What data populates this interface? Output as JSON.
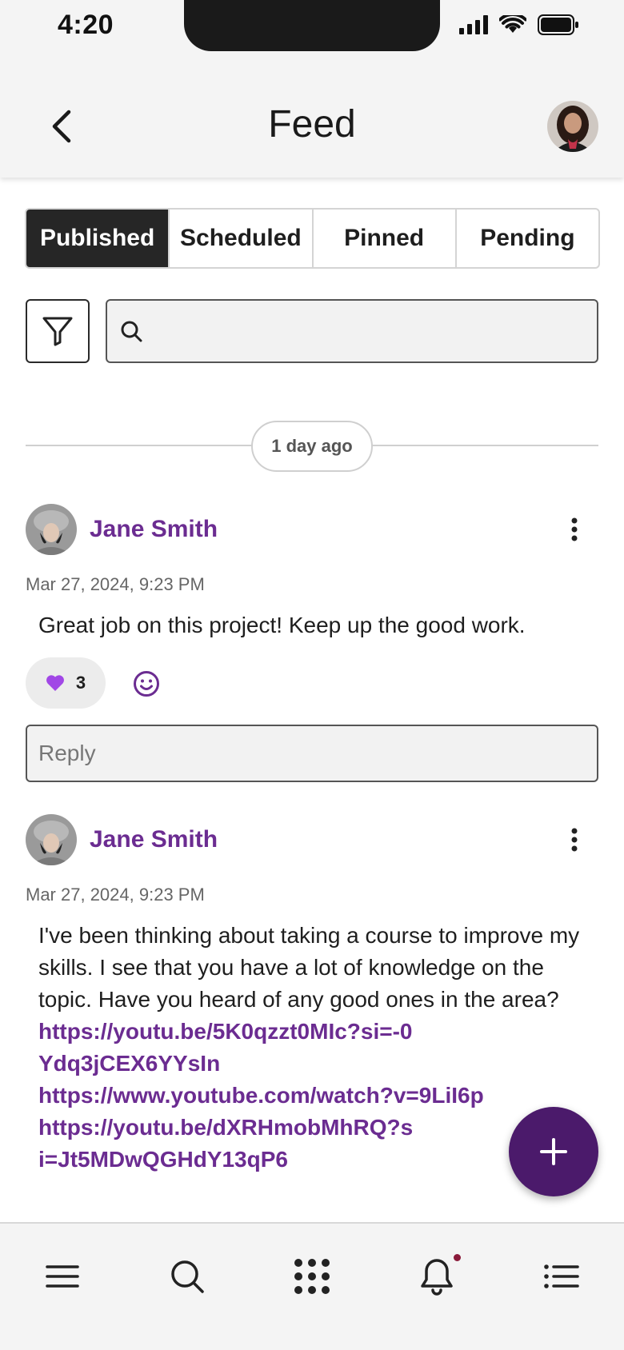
{
  "status_bar": {
    "time": "4:20"
  },
  "header": {
    "title": "Feed"
  },
  "tabs": [
    {
      "label": "Published",
      "active": true
    },
    {
      "label": "Scheduled",
      "active": false
    },
    {
      "label": "Pinned",
      "active": false
    },
    {
      "label": "Pending",
      "active": false
    }
  ],
  "search": {
    "placeholder": "",
    "value": ""
  },
  "date_divider": "1 day ago",
  "posts": [
    {
      "author": "Jane Smith",
      "timestamp": "Mar 27, 2024, 9:23 PM",
      "body": "Great job on this project! Keep up the good work.",
      "reaction": {
        "icon": "purple-heart-icon",
        "count": "3"
      },
      "reply_placeholder": "Reply"
    },
    {
      "author": "Jane Smith",
      "timestamp": "Mar 27, 2024, 9:23 PM",
      "body": "I've been thinking about taking a course to improve my skills. I see that you have a lot of knowledge on the topic. Have you heard of any good ones in the area?",
      "links": [
        "https://youtu.be/5K0qzzt0MIc?si=-0Ydq3jCEX6YYsIn",
        "https://www.youtube.com/watch?v=9LiI6p",
        "https://youtu.be/dXRHmobMhRQ?si=Jt5MDwQGHdY13qP6"
      ]
    }
  ],
  "colors": {
    "accent": "#6b2c91",
    "fab": "#4b1a6b",
    "active_tab": "#262626"
  }
}
